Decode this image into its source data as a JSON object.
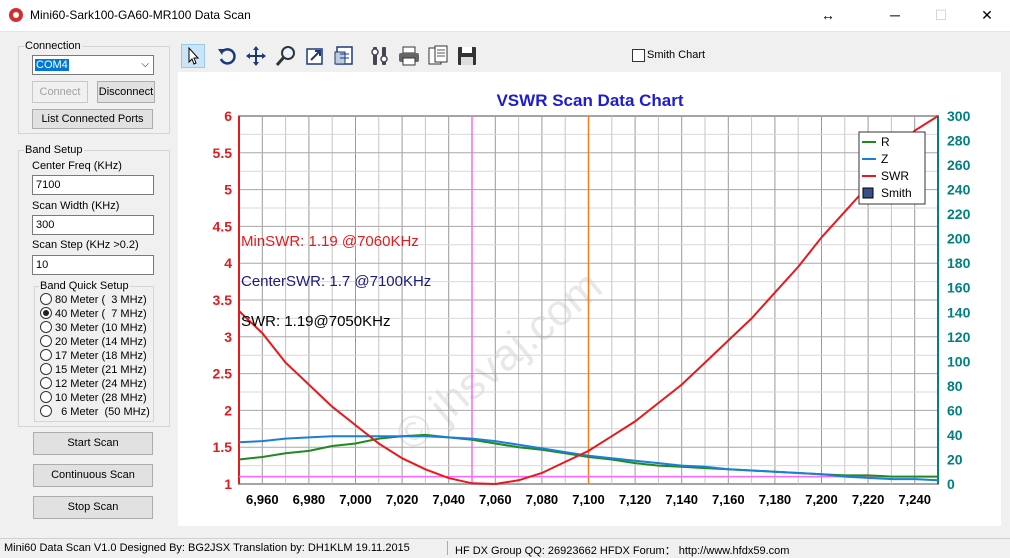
{
  "window": {
    "title": "Mini60-Sark100-GA60-MR100 Data Scan",
    "resize_glyph": "↔",
    "minimize_glyph": "─",
    "maximize_glyph": "☐",
    "close_glyph": "✕"
  },
  "connection": {
    "label": "Connection",
    "port_value": "COM4",
    "connect_label": "Connect",
    "disconnect_label": "Disconnect",
    "list_ports_label": "List Connected Ports"
  },
  "band_setup": {
    "label": "Band Setup",
    "center_freq_label": "Center Freq  (KHz)",
    "center_freq_value": "7100",
    "scan_width_label": "Scan Width   (KHz)",
    "scan_width_value": "300",
    "scan_step_label": "Scan Step     (KHz >0.2)",
    "scan_step_value": "10"
  },
  "band_quick": {
    "label": "Band Quick Setup",
    "items": [
      {
        "label": "80 Meter (  3 MHz)",
        "checked": false
      },
      {
        "label": "40 Meter (  7 MHz)",
        "checked": true
      },
      {
        "label": "30 Meter (10 MHz)",
        "checked": false
      },
      {
        "label": "20 Meter (14 MHz)",
        "checked": false
      },
      {
        "label": "17 Meter (18 MHz)",
        "checked": false
      },
      {
        "label": "15 Meter (21 MHz)",
        "checked": false
      },
      {
        "label": "12 Meter (24 MHz)",
        "checked": false
      },
      {
        "label": "10 Meter (28 MHz)",
        "checked": false
      },
      {
        "label": "  6 Meter  (50 MHz)",
        "checked": false
      }
    ]
  },
  "actions": {
    "start_label": "Start Scan",
    "continuous_label": "Continuous Scan",
    "stop_label": "Stop Scan"
  },
  "toolbar": {
    "smith_chart_label": "Smith Chart",
    "smith_chart_checked": false,
    "icons": [
      "pointer-icon",
      "undo-icon",
      "pan-icon",
      "zoom-icon",
      "export-icon",
      "table-icon",
      "settings-icon",
      "print-icon",
      "document-icon",
      "save-icon"
    ]
  },
  "status": {
    "left": "Mini60 Data Scan V1.0   Designed By: BG2JSX  Translation by: DH1KLM    19.11.2015",
    "right": "HF DX Group QQ: 26923662  HFDX Forum：  http://www.hfdx59.com"
  },
  "colors": {
    "swr": "#e8191d",
    "r": "#1f8a1f",
    "z": "#1a7fd8",
    "right_axis": "#008080",
    "left_axis": "#e8191d",
    "title": "#1d1dcf",
    "marker_pink": "#ff66ff",
    "marker_orange": "#f57c1f"
  },
  "chart_data": {
    "type": "line",
    "title": "VSWR Scan Data Chart",
    "x_ticks": [
      "6,960",
      "6,980",
      "7,000",
      "7,020",
      "7,040",
      "7,060",
      "7,080",
      "7,100",
      "7,120",
      "7,140",
      "7,160",
      "7,180",
      "7,200",
      "7,220",
      "7,240"
    ],
    "x": [
      6950,
      6960,
      6970,
      6980,
      6990,
      7000,
      7010,
      7020,
      7030,
      7040,
      7050,
      7060,
      7070,
      7080,
      7090,
      7100,
      7110,
      7120,
      7130,
      7140,
      7150,
      7160,
      7170,
      7180,
      7190,
      7200,
      7210,
      7220,
      7230,
      7240,
      7250
    ],
    "xlim": [
      6950,
      7250
    ],
    "y_left_ticks": [
      "6",
      "5.5",
      "5",
      "4.5",
      "4",
      "3.5",
      "3",
      "2.5",
      "2",
      "1.5",
      "1"
    ],
    "ylim_left": [
      1,
      6
    ],
    "y_right_ticks": [
      "300",
      "280",
      "260",
      "240",
      "220",
      "200",
      "180",
      "160",
      "140",
      "120",
      "100",
      "80",
      "60",
      "40",
      "20",
      "0"
    ],
    "ylim_right": [
      0,
      300
    ],
    "series": [
      {
        "name": "R",
        "axis": "right",
        "values": [
          20,
          22,
          25,
          27,
          31,
          33,
          37,
          39,
          40,
          38,
          36,
          33,
          30,
          28,
          25,
          22,
          20,
          17,
          15,
          14,
          13,
          12,
          11,
          10,
          9,
          8,
          7,
          7,
          6,
          6,
          6
        ]
      },
      {
        "name": "Z",
        "axis": "right",
        "values": [
          34,
          35,
          37,
          38,
          39,
          39,
          39,
          39,
          39,
          38,
          37,
          35,
          32,
          29,
          26,
          23,
          21,
          19,
          17,
          15,
          14,
          12,
          11,
          10,
          9,
          8,
          6,
          5,
          4,
          4,
          3
        ]
      },
      {
        "name": "SWR",
        "axis": "left",
        "values": [
          3.35,
          3.05,
          2.65,
          2.35,
          2.05,
          1.8,
          1.55,
          1.35,
          1.2,
          1.08,
          1.01,
          1.0,
          1.05,
          1.15,
          1.3,
          1.45,
          1.65,
          1.85,
          2.1,
          2.35,
          2.65,
          2.95,
          3.25,
          3.6,
          3.95,
          4.35,
          4.7,
          5.05,
          5.45,
          5.8,
          6.0
        ]
      }
    ],
    "legend": [
      "R",
      "Z",
      "SWR",
      "Smith"
    ],
    "legend_position": "top-right",
    "grid": true,
    "markers": {
      "pink_vertical": 7050,
      "orange_vertical": 7100,
      "pink_horizontal": 1.19
    },
    "annotations": [
      {
        "text": "MinSWR: 1.19 @7060KHz",
        "color": "#e8191d"
      },
      {
        "text": "CenterSWR: 1.7 @7100KHz",
        "color": "#1a1a80"
      },
      {
        "text": "SWR: 1.19@7050KHz",
        "color": "#000000"
      }
    ],
    "watermark": "© jhsvaj.com"
  }
}
